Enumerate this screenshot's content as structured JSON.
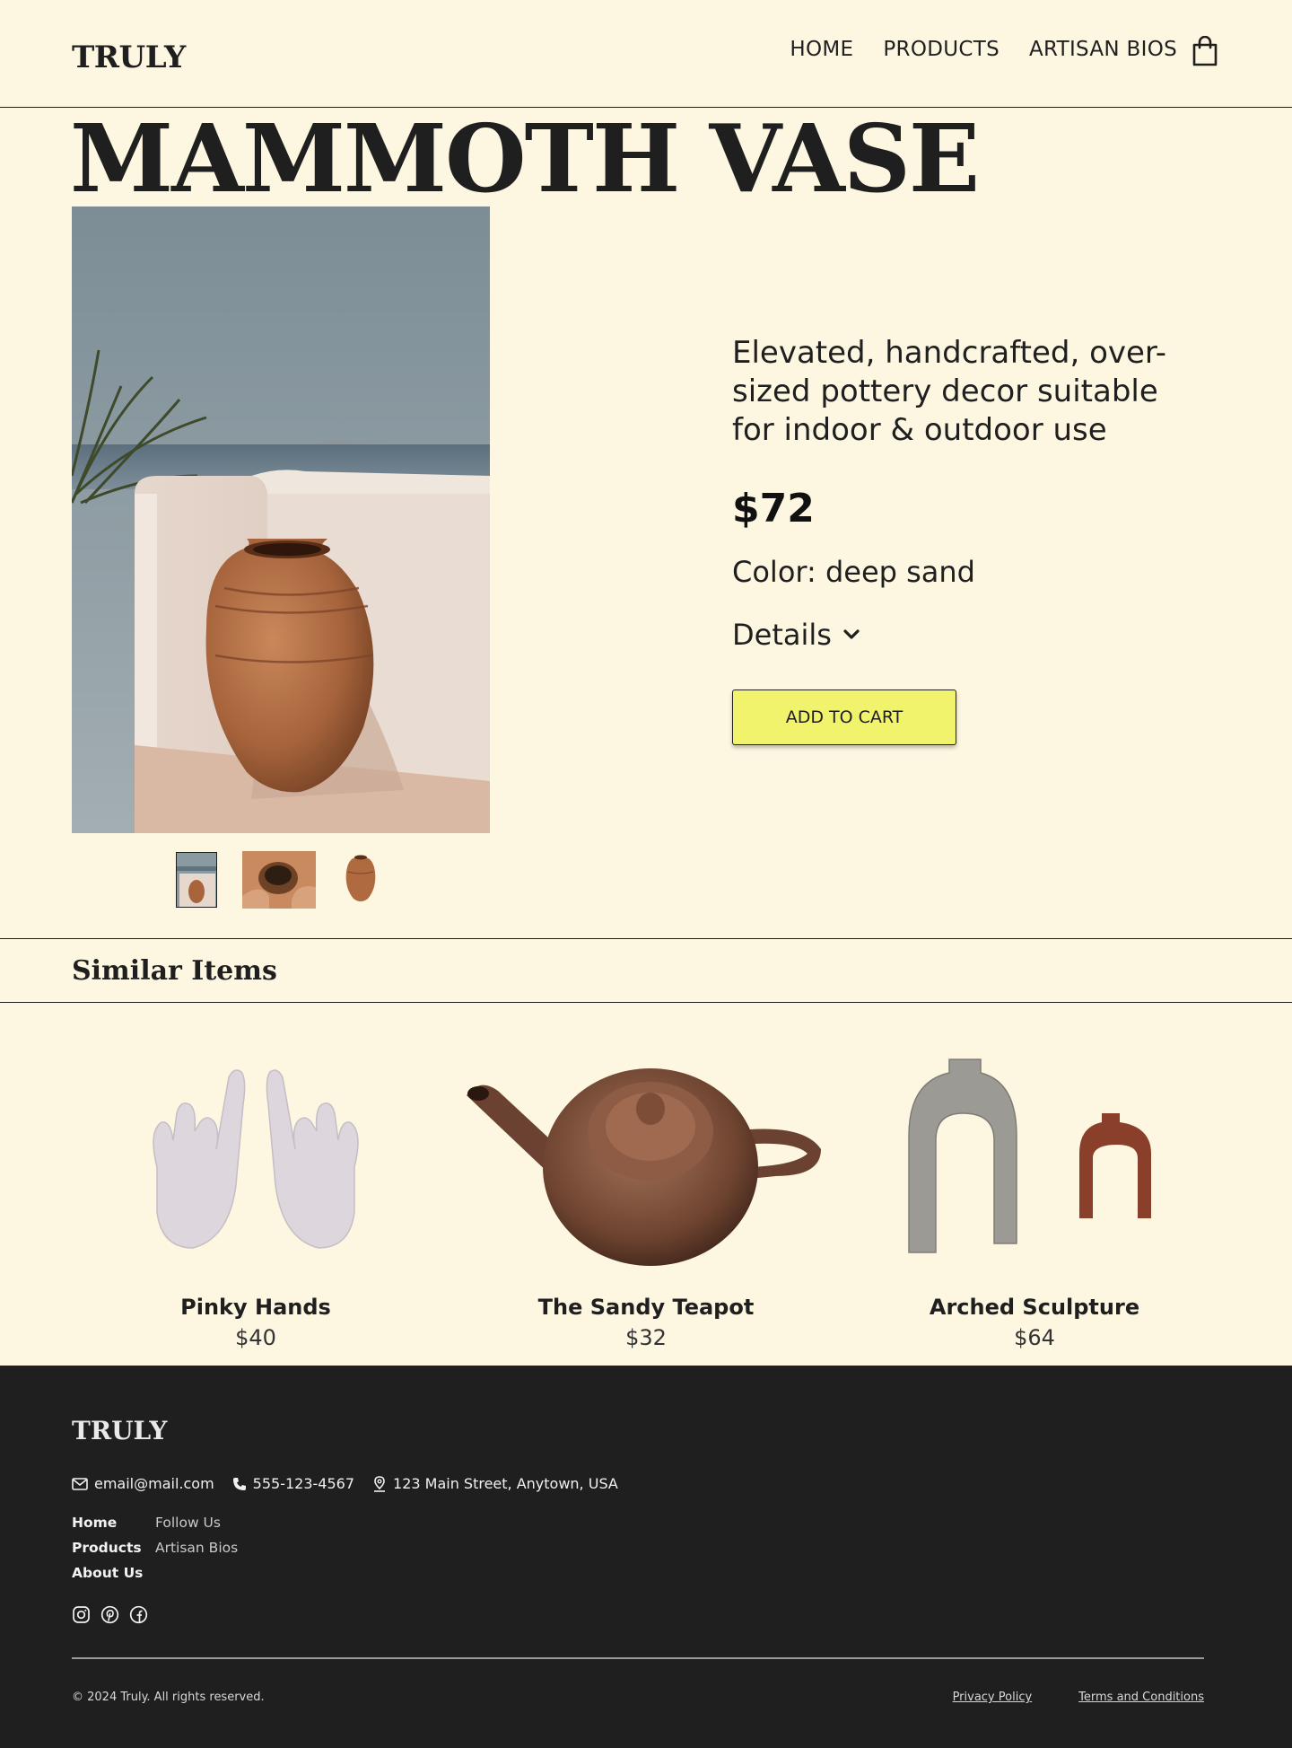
{
  "header": {
    "logo": "TRULY",
    "nav": [
      "HOME",
      "PRODUCTS",
      "ARTISAN BIOS"
    ],
    "cart_icon": "shopping-bag-icon"
  },
  "product": {
    "title": "MAMMOTH VASE",
    "tagline": "Elevated, handcrafted, over-sized pottery decor suitable for indoor & outdoor use",
    "price": "$72",
    "color": "Color: deep sand",
    "details_label": "Details",
    "details_icon": "chevron-down-icon",
    "add_to_cart": "ADD TO CART",
    "thumbnails_count": 3,
    "accent_color": "#f2f36d"
  },
  "similar": {
    "title": "Similar Items",
    "items": [
      {
        "name": "Pinky Hands",
        "price": "$40"
      },
      {
        "name": "The Sandy Teapot",
        "price": "$32"
      },
      {
        "name": "Arched Sculpture",
        "price": "$64"
      }
    ]
  },
  "footer": {
    "logo": "TRULY",
    "email": "email@mail.com",
    "phone": "555-123-4567",
    "address": "123 Main Street, Anytown, USA",
    "links_col1": [
      "Home",
      "Products",
      "About Us"
    ],
    "links_col2": [
      "Follow Us",
      "Artisan Bios"
    ],
    "socials": [
      "instagram-icon",
      "pinterest-icon",
      "facebook-icon"
    ],
    "copyright": "© 2024 Truly. All rights reserved.",
    "legal": [
      "Privacy Policy",
      "Terms and Conditions"
    ],
    "background": "#1f1f1f"
  }
}
